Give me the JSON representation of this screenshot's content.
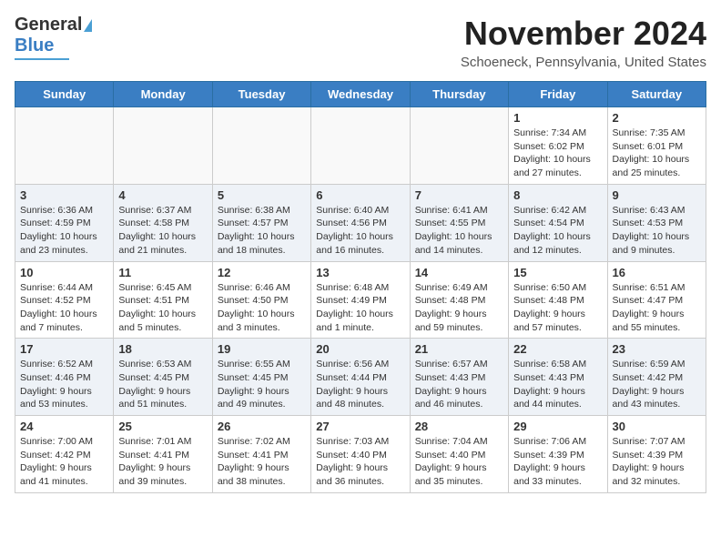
{
  "header": {
    "logo_line1": "General",
    "logo_line2": "Blue",
    "month": "November 2024",
    "location": "Schoeneck, Pennsylvania, United States"
  },
  "days_of_week": [
    "Sunday",
    "Monday",
    "Tuesday",
    "Wednesday",
    "Thursday",
    "Friday",
    "Saturday"
  ],
  "weeks": [
    [
      {
        "day": "",
        "empty": true
      },
      {
        "day": "",
        "empty": true
      },
      {
        "day": "",
        "empty": true
      },
      {
        "day": "",
        "empty": true
      },
      {
        "day": "",
        "empty": true
      },
      {
        "day": "1",
        "sunrise": "7:34 AM",
        "sunset": "6:02 PM",
        "daylight": "10 hours and 27 minutes."
      },
      {
        "day": "2",
        "sunrise": "7:35 AM",
        "sunset": "6:01 PM",
        "daylight": "10 hours and 25 minutes."
      }
    ],
    [
      {
        "day": "3",
        "sunrise": "6:36 AM",
        "sunset": "4:59 PM",
        "daylight": "10 hours and 23 minutes."
      },
      {
        "day": "4",
        "sunrise": "6:37 AM",
        "sunset": "4:58 PM",
        "daylight": "10 hours and 21 minutes."
      },
      {
        "day": "5",
        "sunrise": "6:38 AM",
        "sunset": "4:57 PM",
        "daylight": "10 hours and 18 minutes."
      },
      {
        "day": "6",
        "sunrise": "6:40 AM",
        "sunset": "4:56 PM",
        "daylight": "10 hours and 16 minutes."
      },
      {
        "day": "7",
        "sunrise": "6:41 AM",
        "sunset": "4:55 PM",
        "daylight": "10 hours and 14 minutes."
      },
      {
        "day": "8",
        "sunrise": "6:42 AM",
        "sunset": "4:54 PM",
        "daylight": "10 hours and 12 minutes."
      },
      {
        "day": "9",
        "sunrise": "6:43 AM",
        "sunset": "4:53 PM",
        "daylight": "10 hours and 9 minutes."
      }
    ],
    [
      {
        "day": "10",
        "sunrise": "6:44 AM",
        "sunset": "4:52 PM",
        "daylight": "10 hours and 7 minutes."
      },
      {
        "day": "11",
        "sunrise": "6:45 AM",
        "sunset": "4:51 PM",
        "daylight": "10 hours and 5 minutes."
      },
      {
        "day": "12",
        "sunrise": "6:46 AM",
        "sunset": "4:50 PM",
        "daylight": "10 hours and 3 minutes."
      },
      {
        "day": "13",
        "sunrise": "6:48 AM",
        "sunset": "4:49 PM",
        "daylight": "10 hours and 1 minute."
      },
      {
        "day": "14",
        "sunrise": "6:49 AM",
        "sunset": "4:48 PM",
        "daylight": "9 hours and 59 minutes."
      },
      {
        "day": "15",
        "sunrise": "6:50 AM",
        "sunset": "4:48 PM",
        "daylight": "9 hours and 57 minutes."
      },
      {
        "day": "16",
        "sunrise": "6:51 AM",
        "sunset": "4:47 PM",
        "daylight": "9 hours and 55 minutes."
      }
    ],
    [
      {
        "day": "17",
        "sunrise": "6:52 AM",
        "sunset": "4:46 PM",
        "daylight": "9 hours and 53 minutes."
      },
      {
        "day": "18",
        "sunrise": "6:53 AM",
        "sunset": "4:45 PM",
        "daylight": "9 hours and 51 minutes."
      },
      {
        "day": "19",
        "sunrise": "6:55 AM",
        "sunset": "4:45 PM",
        "daylight": "9 hours and 49 minutes."
      },
      {
        "day": "20",
        "sunrise": "6:56 AM",
        "sunset": "4:44 PM",
        "daylight": "9 hours and 48 minutes."
      },
      {
        "day": "21",
        "sunrise": "6:57 AM",
        "sunset": "4:43 PM",
        "daylight": "9 hours and 46 minutes."
      },
      {
        "day": "22",
        "sunrise": "6:58 AM",
        "sunset": "4:43 PM",
        "daylight": "9 hours and 44 minutes."
      },
      {
        "day": "23",
        "sunrise": "6:59 AM",
        "sunset": "4:42 PM",
        "daylight": "9 hours and 43 minutes."
      }
    ],
    [
      {
        "day": "24",
        "sunrise": "7:00 AM",
        "sunset": "4:42 PM",
        "daylight": "9 hours and 41 minutes."
      },
      {
        "day": "25",
        "sunrise": "7:01 AM",
        "sunset": "4:41 PM",
        "daylight": "9 hours and 39 minutes."
      },
      {
        "day": "26",
        "sunrise": "7:02 AM",
        "sunset": "4:41 PM",
        "daylight": "9 hours and 38 minutes."
      },
      {
        "day": "27",
        "sunrise": "7:03 AM",
        "sunset": "4:40 PM",
        "daylight": "9 hours and 36 minutes."
      },
      {
        "day": "28",
        "sunrise": "7:04 AM",
        "sunset": "4:40 PM",
        "daylight": "9 hours and 35 minutes."
      },
      {
        "day": "29",
        "sunrise": "7:06 AM",
        "sunset": "4:39 PM",
        "daylight": "9 hours and 33 minutes."
      },
      {
        "day": "30",
        "sunrise": "7:07 AM",
        "sunset": "4:39 PM",
        "daylight": "9 hours and 32 minutes."
      }
    ]
  ]
}
